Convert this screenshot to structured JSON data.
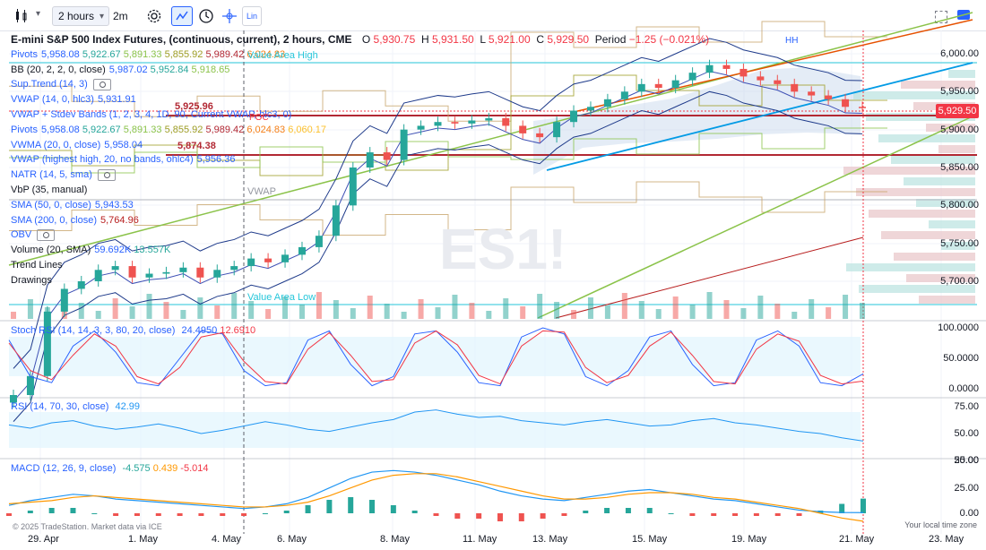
{
  "toolbar": {
    "chart_type_icon": "candles-icon",
    "interval_label": "2 hours",
    "interval_short": "2m",
    "settings_icon": "gear-icon",
    "indicators_icon": "trend-icon",
    "replay_icon": "clock-icon",
    "crosshair_icon": "crosshair-icon",
    "lin_label": "Lin"
  },
  "symbol": {
    "title": "E-mini S&P 500 Index Futures, (continuous, current), 2 hours, CME",
    "o_label": "O",
    "o": "5,930.75",
    "h_label": "H",
    "h": "5,931.50",
    "l_label": "L",
    "l": "5,921.00",
    "c_label": "C",
    "c": "5,929.50",
    "period_label": "Period",
    "period": "−1.25 (−0.021%)"
  },
  "legend": [
    {
      "name": "Pivots",
      "values": [
        "5,958.08",
        "5,922.67",
        "5,891.33",
        "5,855.92",
        "5,989.42",
        "6,024.83"
      ]
    },
    {
      "name": "BB (20, 2, 2, 0, close)",
      "values": [
        "5,987.02",
        "5,952.84",
        "5,918.65"
      ]
    },
    {
      "name": "Sup.Trend (14, 3)",
      "values": []
    },
    {
      "name": "VWAP (14, 0, hlc3)",
      "values": [
        "5,931.91"
      ]
    },
    {
      "name": "VWAP + Stdev Bands (1, 2, 3, 4, 1D, 90, Current VWAP, hlc3, 0)",
      "values": []
    },
    {
      "name": "Pivots",
      "values": [
        "5,958.08",
        "5,922.67",
        "5,891.33",
        "5,855.92",
        "5,989.42",
        "6,024.83",
        "6,060.17"
      ]
    },
    {
      "name": "VWMA (20, 0, close)",
      "values": [
        "5,958.04"
      ]
    },
    {
      "name": "VWAP (highest high, 20, no bands, ohlc4)",
      "values": [
        "5,956.36"
      ]
    },
    {
      "name": "NATR (14, 5, sma)",
      "values": []
    },
    {
      "name": "VbP (35, manual)",
      "values": []
    },
    {
      "name": "SMA (50, 0, close)",
      "values": [
        "5,943.53"
      ]
    },
    {
      "name": "SMA (200, 0, close)",
      "values": [
        "5,764.96"
      ]
    },
    {
      "name": "OBV",
      "values": []
    },
    {
      "name": "Volume (20, SMA)",
      "values": [
        "59.692K",
        "13.557K"
      ]
    },
    {
      "name": "Trend Lines",
      "values": []
    },
    {
      "name": "Drawings",
      "values": []
    }
  ],
  "annotations": {
    "value_area_high": "Value Area High",
    "value_area_low": "Value Area Low",
    "vwap": "VWAP",
    "poc": "POC",
    "hh": "HH",
    "level_1": "5,925.96",
    "level_2": "5,874.38",
    "watermark": "ES1!"
  },
  "price_badge": "5,929.50",
  "price_axis": [
    "6,000.00",
    "5,950.00",
    "5,900.00",
    "5,850.00",
    "5,800.00",
    "5,750.00",
    "5,700.00"
  ],
  "stoch": {
    "name": "Stoch RSI (14, 14, 3, 3, 80, 20, close)",
    "k": "24.4950",
    "d": "12.6910",
    "axis": [
      "100.0000",
      "50.0000",
      "0.0000"
    ]
  },
  "rsi": {
    "name": "RSI (14, 70, 30, close)",
    "value": "42.99",
    "axis": [
      "75.00",
      "50.00",
      "25.00"
    ]
  },
  "macd": {
    "name": "MACD (12, 26, 9, close)",
    "hist": "-4.575",
    "macd": "0.439",
    "signal": "-5.014",
    "axis": [
      "50.00",
      "25.00",
      "0.00"
    ]
  },
  "x_axis": [
    "29. Apr",
    "1. May",
    "4. May",
    "6. May",
    "8. May",
    "11. May",
    "13. May",
    "15. May",
    "19. May",
    "21. May",
    "23. May"
  ],
  "footer": {
    "attribution": "© 2025 TradeStation. Market data via ICE",
    "timezone": "Your local time zone"
  },
  "colors": {
    "up": "#26a69a",
    "down": "#ef5350",
    "accent": "#2962ff",
    "level": "#b22833",
    "badge": "#f23645"
  },
  "chart_data": {
    "type": "candlestick",
    "symbol": "ES1!",
    "price_range": [
      5650,
      6050
    ],
    "x": [
      "29. Apr",
      "1. May",
      "4. May",
      "6. May",
      "8. May",
      "11. May",
      "13. May",
      "15. May",
      "19. May",
      "21. May"
    ],
    "close": [
      5550,
      5575,
      5660,
      5690,
      5700,
      5715,
      5720,
      5705,
      5710,
      5712,
      5718,
      5705,
      5715,
      5720,
      5730,
      5725,
      5735,
      5745,
      5760,
      5800,
      5850,
      5870,
      5860,
      5900,
      5905,
      5910,
      5908,
      5912,
      5915,
      5905,
      5895,
      5890,
      5910,
      5925,
      5930,
      5940,
      5950,
      5960,
      5955,
      5965,
      5975,
      5985,
      5980,
      5970,
      5965,
      5960,
      5950,
      5945,
      5940,
      5930,
      5929.5
    ],
    "stoch_k": [
      80,
      20,
      10,
      70,
      95,
      60,
      10,
      5,
      50,
      95,
      90,
      30,
      5,
      10,
      80,
      95,
      40,
      5,
      20,
      90,
      95,
      60,
      10,
      5,
      85,
      100,
      90,
      20,
      5,
      30,
      85,
      95,
      40,
      5,
      10,
      80,
      95,
      70,
      10,
      5,
      24.5
    ],
    "stoch_d": [
      75,
      30,
      15,
      55,
      90,
      70,
      20,
      8,
      35,
      85,
      92,
      45,
      12,
      8,
      65,
      92,
      55,
      12,
      15,
      75,
      95,
      72,
      22,
      8,
      70,
      95,
      93,
      35,
      10,
      22,
      70,
      93,
      55,
      12,
      8,
      65,
      90,
      78,
      22,
      8,
      12.7
    ],
    "rsi": [
      58,
      55,
      60,
      62,
      57,
      54,
      56,
      59,
      55,
      50,
      53,
      57,
      61,
      58,
      54,
      52,
      56,
      60,
      63,
      70,
      72,
      68,
      65,
      66,
      62,
      60,
      58,
      61,
      63,
      60,
      57,
      58,
      62,
      64,
      60,
      58,
      55,
      52,
      50,
      46,
      42.99
    ],
    "macd": [
      5,
      8,
      10,
      12,
      11,
      9,
      8,
      7,
      6,
      5,
      4,
      3,
      4,
      6,
      10,
      16,
      22,
      26,
      27,
      26,
      24,
      21,
      18,
      14,
      11,
      9,
      8,
      10,
      12,
      14,
      15,
      13,
      11,
      9,
      8,
      6,
      4,
      2,
      1,
      0.5,
      0.439
    ],
    "signal": [
      6,
      7,
      8,
      10,
      11,
      10,
      9,
      8,
      7,
      6,
      5,
      4,
      4,
      5,
      7,
      11,
      16,
      21,
      24,
      25,
      25,
      23,
      20,
      17,
      14,
      11,
      9,
      9,
      10,
      12,
      13,
      13,
      12,
      10,
      9,
      7,
      5,
      3,
      0,
      -3,
      -5.014
    ]
  }
}
